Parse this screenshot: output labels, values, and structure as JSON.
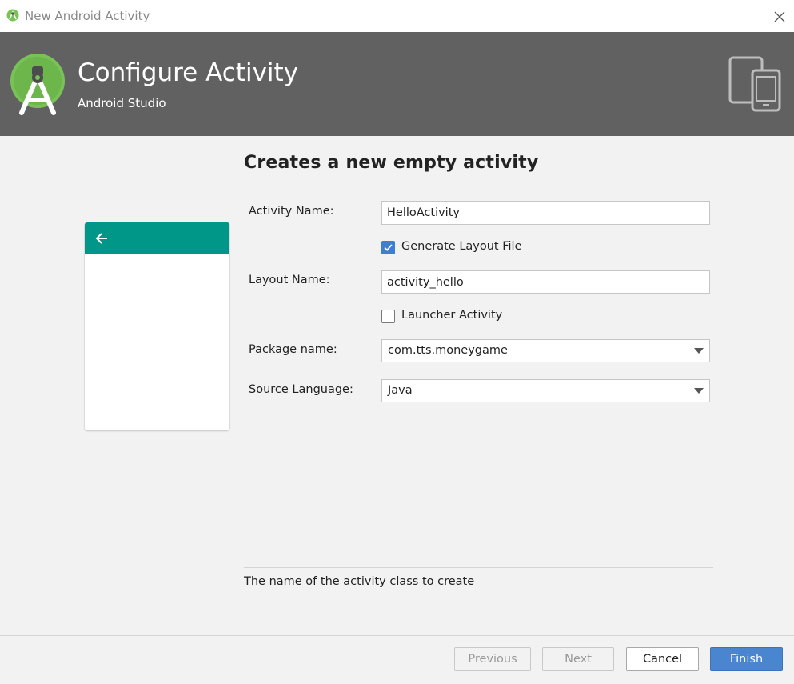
{
  "window": {
    "title": "New Android Activity"
  },
  "header": {
    "title": "Configure Activity",
    "subtitle": "Android Studio"
  },
  "form": {
    "heading": "Creates a new empty activity",
    "activity_name": {
      "label": "Activity Name:",
      "value": "HelloActivity"
    },
    "generate_layout": {
      "label": "Generate Layout File",
      "checked": true
    },
    "layout_name": {
      "label": "Layout Name:",
      "value": "activity_hello"
    },
    "launcher_activity": {
      "label": "Launcher Activity",
      "checked": false
    },
    "package_name": {
      "label": "Package name:",
      "value": "com.tts.moneygame"
    },
    "source_language": {
      "label": "Source Language:",
      "value": "Java"
    }
  },
  "description": "The name of the activity class to create",
  "buttons": {
    "previous": "Previous",
    "next": "Next",
    "cancel": "Cancel",
    "finish": "Finish"
  },
  "colors": {
    "header_bg": "#616161",
    "preview_appbar": "#009688",
    "accent": "#4a85cf",
    "android_green": "#78c257"
  },
  "icons": [
    "android-studio-icon",
    "close-icon",
    "android-studio-logo-icon",
    "devices-icon",
    "back-arrow-icon",
    "checkmark-icon",
    "dropdown-arrow-icon"
  ]
}
